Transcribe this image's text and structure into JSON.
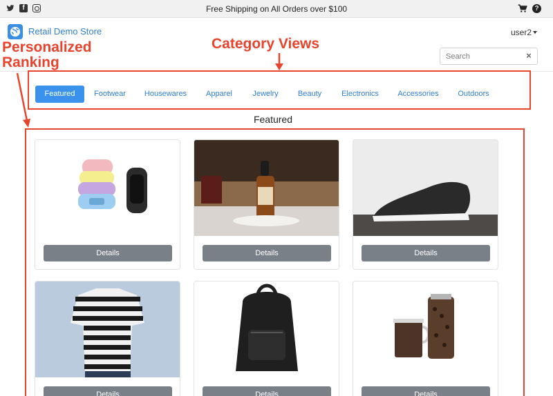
{
  "topbar": {
    "promo": "Free Shipping on All Orders over $100",
    "help_glyph": "?"
  },
  "header": {
    "brand": "Retail Demo Store",
    "user": "user2",
    "search_placeholder": "Search",
    "search_clear": "×"
  },
  "annotations": {
    "personalized_line1": "Personalized",
    "personalized_line2": "Ranking",
    "category_views": "Category Views",
    "color": "#e8432d"
  },
  "categories": [
    {
      "label": "Featured",
      "active": true
    },
    {
      "label": "Footwear",
      "active": false
    },
    {
      "label": "Housewares",
      "active": false
    },
    {
      "label": "Apparel",
      "active": false
    },
    {
      "label": "Jewelry",
      "active": false
    },
    {
      "label": "Beauty",
      "active": false
    },
    {
      "label": "Electronics",
      "active": false
    },
    {
      "label": "Accessories",
      "active": false
    },
    {
      "label": "Outdoors",
      "active": false
    }
  ],
  "section_title": "Featured",
  "products": [
    {
      "image": "fitness-tracker-bands",
      "button": "Details"
    },
    {
      "image": "dropper-bottle",
      "button": "Details"
    },
    {
      "image": "black-sneaker",
      "button": "Details"
    },
    {
      "image": "striped-tshirt",
      "button": "Details"
    },
    {
      "image": "black-backpack",
      "button": "Details"
    },
    {
      "image": "coffee-jar-and-cup",
      "button": "Details"
    }
  ],
  "colors": {
    "accent": "#3a92ec",
    "link": "#2f7fd6",
    "button": "#7a8088",
    "annotation": "#e8432d"
  }
}
